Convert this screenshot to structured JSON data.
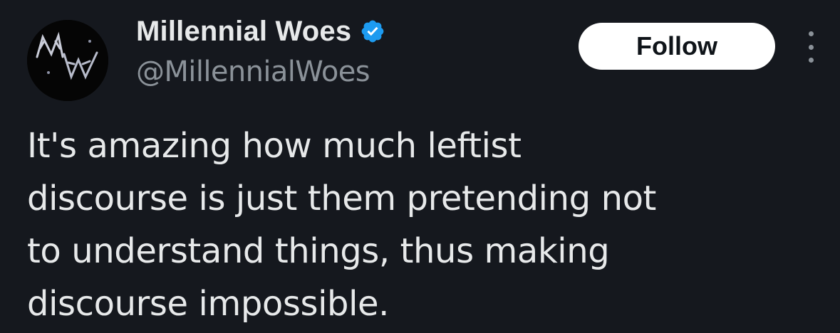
{
  "author": {
    "avatar_icon": "millennial-woes-monogram-icon",
    "avatar_text": "MW",
    "display_name": "Millennial Woes",
    "handle": "@MillennialWoes",
    "verified_icon": "verified-badge-icon"
  },
  "actions": {
    "follow_label": "Follow",
    "more_icon": "more-vertical-icon"
  },
  "tweet": {
    "text": "It's amazing how much leftist\ndiscourse is just them pretending not\nto understand things, thus making\ndiscourse impossible."
  },
  "colors": {
    "background": "#15181e",
    "text_primary": "#e7e9ea",
    "text_secondary": "#8b9299",
    "verified_blue": "#1d9bf0",
    "follow_bg": "#ffffff"
  }
}
